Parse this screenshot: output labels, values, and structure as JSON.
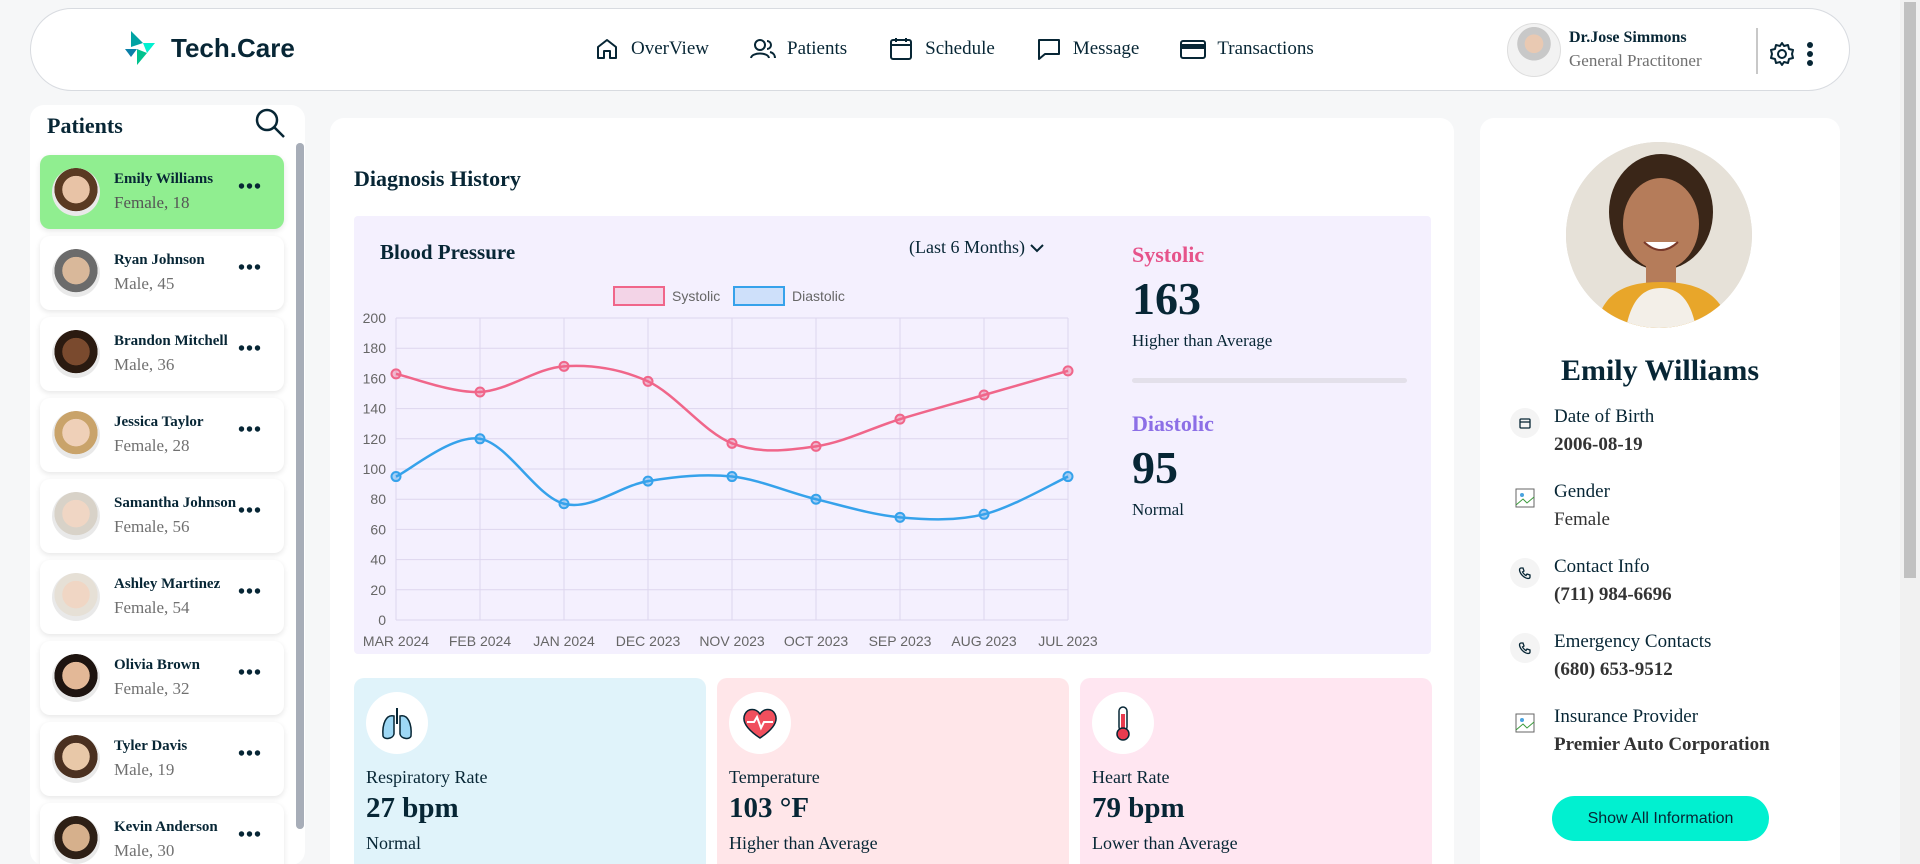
{
  "brand": {
    "name": "Tech.Care"
  },
  "nav": [
    {
      "label": "OverView",
      "icon": "home-icon"
    },
    {
      "label": "Patients",
      "icon": "users-icon"
    },
    {
      "label": "Schedule",
      "icon": "calendar-icon"
    },
    {
      "label": "Message",
      "icon": "chat-icon"
    },
    {
      "label": "Transactions",
      "icon": "credit-card-icon"
    }
  ],
  "doctor": {
    "name": "Dr.Jose Simmons",
    "role": "General Practitoner"
  },
  "patients_panel": {
    "title": "Patients",
    "items": [
      {
        "name": "Emily Williams",
        "info": "Female, 18",
        "active": true
      },
      {
        "name": "Ryan Johnson",
        "info": "Male, 45"
      },
      {
        "name": "Brandon Mitchell",
        "info": "Male, 36"
      },
      {
        "name": "Jessica Taylor",
        "info": "Female, 28"
      },
      {
        "name": "Samantha Johnson",
        "info": "Female, 56"
      },
      {
        "name": "Ashley Martinez",
        "info": "Female, 54"
      },
      {
        "name": "Olivia Brown",
        "info": "Female, 32"
      },
      {
        "name": "Tyler Davis",
        "info": "Male, 19"
      },
      {
        "name": "Kevin Anderson",
        "info": "Male, 30"
      }
    ]
  },
  "diagnosis": {
    "title": "Diagnosis History",
    "chart_title": "Blood Pressure",
    "range_label": "(Last 6 Months)",
    "systolic": {
      "label": "Systolic",
      "value": "163",
      "note": "Higher than Average",
      "color": "#e66fd2"
    },
    "diastolic": {
      "label": "Diastolic",
      "value": "95",
      "note": "Normal",
      "color": "#8c6fe6"
    }
  },
  "chart_data": {
    "type": "line",
    "title": "Blood Pressure",
    "categories": [
      "MAR 2024",
      "FEB 2024",
      "JAN 2024",
      "DEC 2023",
      "NOV 2023",
      "OCT 2023",
      "SEP 2023",
      "AUG 2023",
      "JUL 2023"
    ],
    "series": [
      {
        "name": "Systolic",
        "values": [
          163,
          151,
          168,
          158,
          117,
          115,
          133,
          149,
          165
        ],
        "color": "#f0668a"
      },
      {
        "name": "Diastolic",
        "values": [
          95,
          120,
          77,
          92,
          95,
          80,
          68,
          70,
          95
        ],
        "color": "#36a2eb"
      }
    ],
    "ylim": [
      0,
      200
    ],
    "yticks": [
      0,
      20,
      40,
      60,
      80,
      100,
      120,
      140,
      160,
      180,
      200
    ],
    "grid": true,
    "legend": "top"
  },
  "vitals": [
    {
      "label": "Respiratory Rate",
      "value": "27 bpm",
      "note": "Normal",
      "icon": "lungs-icon",
      "bg": "#e0f3fa"
    },
    {
      "label": "Temperature",
      "value": "103 °F",
      "note": "Higher than Average",
      "icon": "heart-icon",
      "bg": "#ffe6e9"
    },
    {
      "label": "Heart Rate",
      "value": "79 bpm",
      "note": "Lower than Average",
      "icon": "thermometer-icon",
      "bg": "#ffe6f1"
    }
  ],
  "profile": {
    "name": "Emily Williams",
    "fields": [
      {
        "label": "Date of Birth",
        "value": "2006-08-19",
        "icon": "calendar-icon"
      },
      {
        "label": "Gender",
        "value": "Female",
        "icon": "broken-image-icon"
      },
      {
        "label": "Contact Info",
        "value": "(711) 984-6696",
        "icon": "phone-icon"
      },
      {
        "label": "Emergency Contacts",
        "value": "(680) 653-9512",
        "icon": "phone-icon"
      },
      {
        "label": "Insurance Provider",
        "value": "Premier Auto Corporation",
        "icon": "broken-image-icon"
      }
    ],
    "button": "Show All Information"
  }
}
